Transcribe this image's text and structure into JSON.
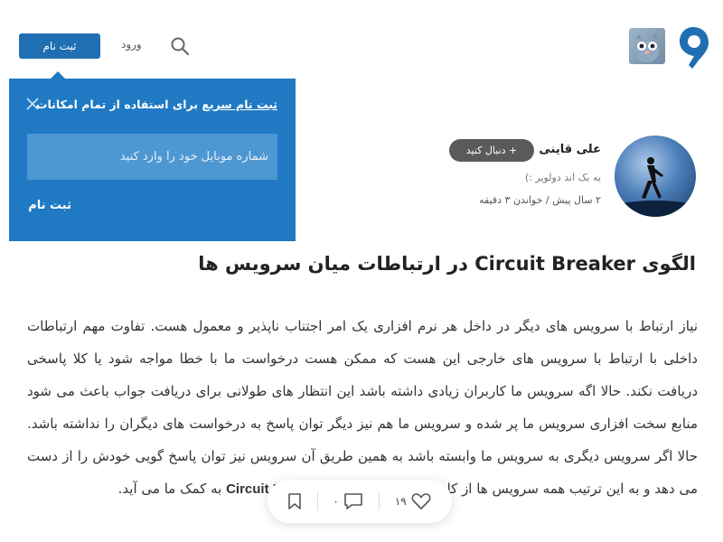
{
  "header": {
    "signup_label": "ثبت نام",
    "login_label": "ورود",
    "icons": {
      "logo": "virgool-logo",
      "search": "search-icon"
    }
  },
  "popup": {
    "title_highlight": "ثبت نام سریع",
    "title_rest": " برای استفاده از تمام امکانات",
    "phone_placeholder": "شماره موبایل خود را وارد کنید",
    "signup_label": "ثبت نام",
    "accent": "#1f7ac3"
  },
  "author": {
    "name": "علی قاینی",
    "follow_label": "+ دنبال کنید",
    "bio": "یه بک اند دولوپر :)",
    "meta": "۲ سال پیش / خواندن ۳ دقیقه"
  },
  "post": {
    "title": "الگوی Circuit Breaker در ارتباطات میان سرویس ها",
    "body_main": "نیاز ارتباط با سرویس های دیگر در داخل هر نرم افزاری یک امر اجتناب ناپذیر و معمول هست. تفاوت مهم ارتباطات داخلی با ارتباط با سرویس های خارجی این هست که ممکن هست درخواست ما با خطا مواجه شود یا کلا پاسخی دریافت نکند. حالا اگه سرویس ما کاربران زیادی داشته باشد این انتظار های طولانی برای دریافت جواب باعث می شود منابع سخت افزاری سرویس ما پر شده و سرویس ما هم نیز دیگر توان پاسخ به درخواست های دیگران را نداشته باشد. حالا اگر سرویس دیگری به سرویس ما وابسته باشد به همین طریق آن سرویس نیز توان پاسخ گویی خودش را از دست می دهد و به این ترتیب همه سرویس ها از کار می افتند. در این جا ",
    "body_term": "Circuit Breaker",
    "body_end": " به کمک ما می آید."
  },
  "actions": {
    "likes": "۱۹",
    "comments": "۰"
  }
}
